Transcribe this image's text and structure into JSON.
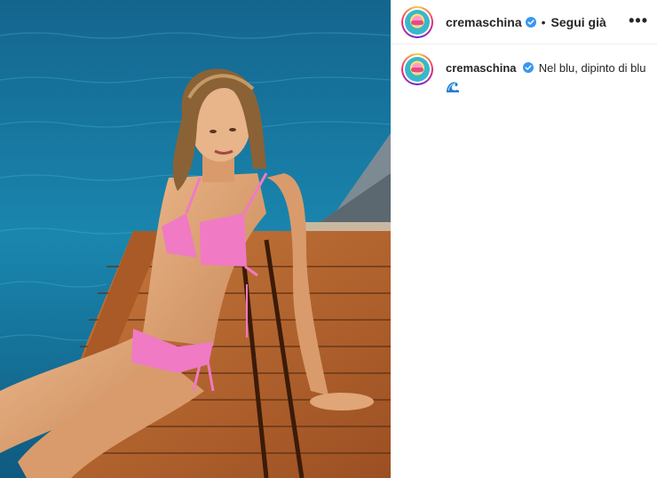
{
  "post": {
    "username": "cremaschina",
    "separator": "•",
    "follow_label": "Segui già",
    "more_label": "•••",
    "caption_user": "cremaschina",
    "caption_text": "Nel blu, dipinto di blu",
    "caption_emoji": "wave-emoji"
  },
  "colors": {
    "sea": "#1376a0",
    "deck": "#b5652e",
    "bikini": "#f07ac4",
    "verified": "#3897f0"
  },
  "icons": {
    "verified": "verified-badge-icon",
    "more": "more-options-icon"
  }
}
